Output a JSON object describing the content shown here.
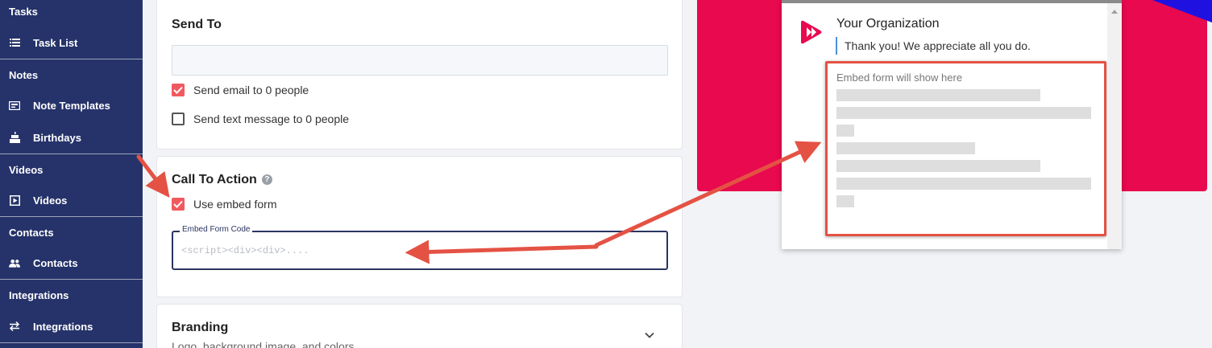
{
  "sidebar": {
    "sections": [
      {
        "title": "Tasks",
        "items": [
          {
            "label": "Task List",
            "icon": "list-icon"
          }
        ]
      },
      {
        "title": "Notes",
        "items": [
          {
            "label": "Note Templates",
            "icon": "note-template-icon"
          },
          {
            "label": "Birthdays",
            "icon": "cake-icon"
          }
        ]
      },
      {
        "title": "Videos",
        "items": [
          {
            "label": "Videos",
            "icon": "play-box-icon"
          }
        ]
      },
      {
        "title": "Contacts",
        "items": [
          {
            "label": "Contacts",
            "icon": "people-icon"
          }
        ]
      },
      {
        "title": "Integrations",
        "items": [
          {
            "label": "Integrations",
            "icon": "swap-arrows-icon"
          }
        ]
      }
    ]
  },
  "send_to": {
    "title": "Send To",
    "recipients_value": "",
    "email_option": {
      "label": "Send email to 0 people",
      "checked": true
    },
    "text_option": {
      "label": "Send text message to 0 people",
      "checked": false
    }
  },
  "call_to_action": {
    "title": "Call To Action",
    "help_icon": "help-icon",
    "use_embed": {
      "label": "Use embed form",
      "checked": true
    },
    "embed_field": {
      "label": "Embed Form Code",
      "placeholder": "<script><div><div>....",
      "value": ""
    }
  },
  "branding": {
    "title": "Branding",
    "subtitle": "Logo, background image, and colors",
    "expand_icon": "chevron-down-icon"
  },
  "preview": {
    "org_name": "Your Organization",
    "thank_you": "Thank you! We appreciate all you do.",
    "embed_placeholder": "Embed form will show here",
    "colors": {
      "background": "#e8094e",
      "highlight": "#e45244",
      "accent_corner": "#1f12e0",
      "checkbox": "#f05a5f",
      "sidebar": "#26336a"
    }
  }
}
